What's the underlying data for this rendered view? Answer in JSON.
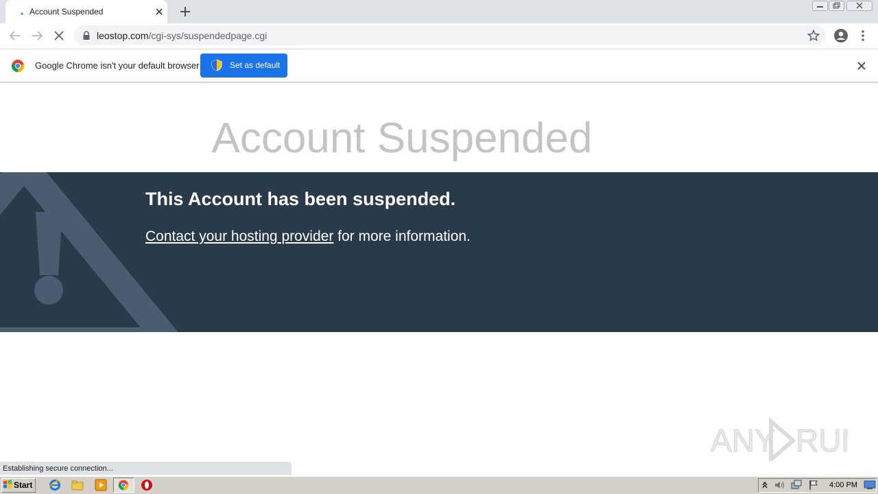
{
  "browser": {
    "tab": {
      "title": "Account Suspended"
    },
    "address": {
      "host": "leostop.com",
      "path": "/cgi-sys/suspendedpage.cgi"
    },
    "infobar": {
      "message": "Google Chrome isn't your default browser",
      "button_label": "Set as default"
    },
    "status": "Establishing secure connection..."
  },
  "page": {
    "title": "Account Suspended",
    "banner": {
      "heading": "This Account has been suspended.",
      "link_text": "Contact your hosting provider",
      "suffix": " for more information."
    }
  },
  "watermark": {
    "text": "ANY RUN"
  },
  "taskbar": {
    "start_label": "Start",
    "clock": "4:00 PM"
  },
  "colors": {
    "banner_bg": "#293a4a",
    "title_gray": "#c4c4c4",
    "chrome_blue": "#1a73e8"
  }
}
